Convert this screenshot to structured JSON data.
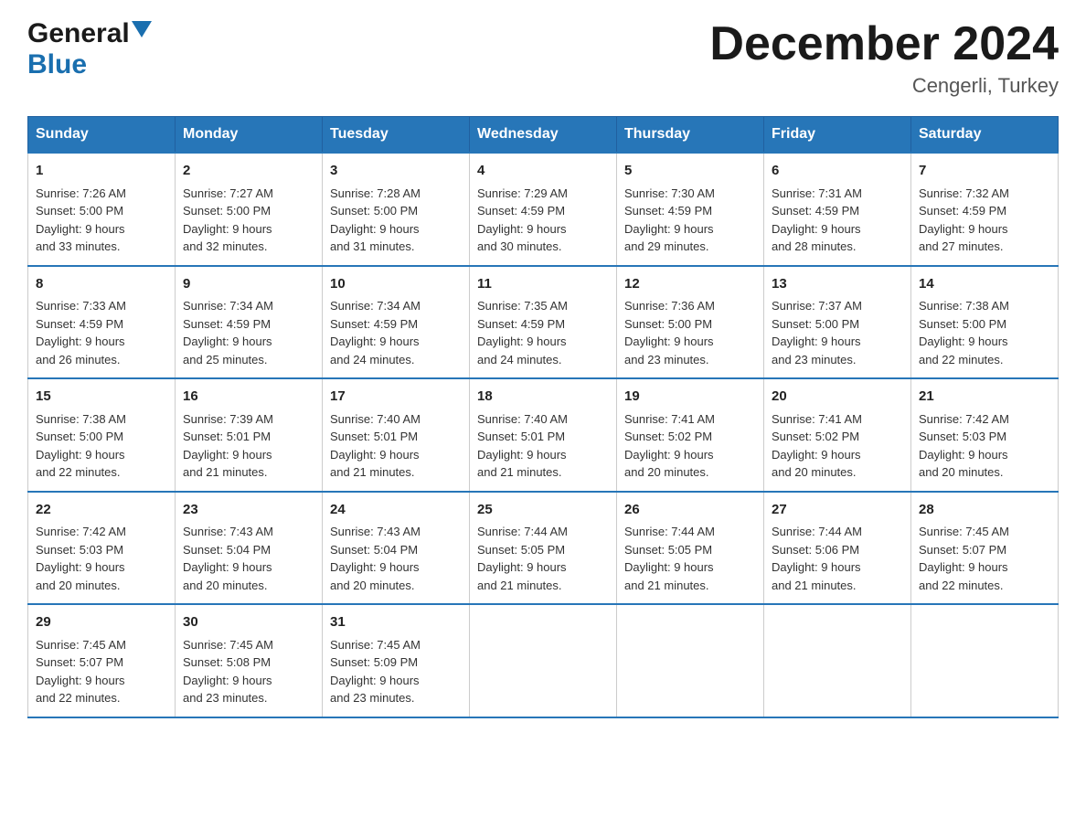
{
  "header": {
    "logo_general": "General",
    "logo_blue": "Blue",
    "month_title": "December 2024",
    "location": "Cengerli, Turkey"
  },
  "days_of_week": [
    "Sunday",
    "Monday",
    "Tuesday",
    "Wednesday",
    "Thursday",
    "Friday",
    "Saturday"
  ],
  "weeks": [
    [
      {
        "day": "1",
        "sunrise": "7:26 AM",
        "sunset": "5:00 PM",
        "daylight": "9 hours and 33 minutes."
      },
      {
        "day": "2",
        "sunrise": "7:27 AM",
        "sunset": "5:00 PM",
        "daylight": "9 hours and 32 minutes."
      },
      {
        "day": "3",
        "sunrise": "7:28 AM",
        "sunset": "5:00 PM",
        "daylight": "9 hours and 31 minutes."
      },
      {
        "day": "4",
        "sunrise": "7:29 AM",
        "sunset": "4:59 PM",
        "daylight": "9 hours and 30 minutes."
      },
      {
        "day": "5",
        "sunrise": "7:30 AM",
        "sunset": "4:59 PM",
        "daylight": "9 hours and 29 minutes."
      },
      {
        "day": "6",
        "sunrise": "7:31 AM",
        "sunset": "4:59 PM",
        "daylight": "9 hours and 28 minutes."
      },
      {
        "day": "7",
        "sunrise": "7:32 AM",
        "sunset": "4:59 PM",
        "daylight": "9 hours and 27 minutes."
      }
    ],
    [
      {
        "day": "8",
        "sunrise": "7:33 AM",
        "sunset": "4:59 PM",
        "daylight": "9 hours and 26 minutes."
      },
      {
        "day": "9",
        "sunrise": "7:34 AM",
        "sunset": "4:59 PM",
        "daylight": "9 hours and 25 minutes."
      },
      {
        "day": "10",
        "sunrise": "7:34 AM",
        "sunset": "4:59 PM",
        "daylight": "9 hours and 24 minutes."
      },
      {
        "day": "11",
        "sunrise": "7:35 AM",
        "sunset": "4:59 PM",
        "daylight": "9 hours and 24 minutes."
      },
      {
        "day": "12",
        "sunrise": "7:36 AM",
        "sunset": "5:00 PM",
        "daylight": "9 hours and 23 minutes."
      },
      {
        "day": "13",
        "sunrise": "7:37 AM",
        "sunset": "5:00 PM",
        "daylight": "9 hours and 23 minutes."
      },
      {
        "day": "14",
        "sunrise": "7:38 AM",
        "sunset": "5:00 PM",
        "daylight": "9 hours and 22 minutes."
      }
    ],
    [
      {
        "day": "15",
        "sunrise": "7:38 AM",
        "sunset": "5:00 PM",
        "daylight": "9 hours and 22 minutes."
      },
      {
        "day": "16",
        "sunrise": "7:39 AM",
        "sunset": "5:01 PM",
        "daylight": "9 hours and 21 minutes."
      },
      {
        "day": "17",
        "sunrise": "7:40 AM",
        "sunset": "5:01 PM",
        "daylight": "9 hours and 21 minutes."
      },
      {
        "day": "18",
        "sunrise": "7:40 AM",
        "sunset": "5:01 PM",
        "daylight": "9 hours and 21 minutes."
      },
      {
        "day": "19",
        "sunrise": "7:41 AM",
        "sunset": "5:02 PM",
        "daylight": "9 hours and 20 minutes."
      },
      {
        "day": "20",
        "sunrise": "7:41 AM",
        "sunset": "5:02 PM",
        "daylight": "9 hours and 20 minutes."
      },
      {
        "day": "21",
        "sunrise": "7:42 AM",
        "sunset": "5:03 PM",
        "daylight": "9 hours and 20 minutes."
      }
    ],
    [
      {
        "day": "22",
        "sunrise": "7:42 AM",
        "sunset": "5:03 PM",
        "daylight": "9 hours and 20 minutes."
      },
      {
        "day": "23",
        "sunrise": "7:43 AM",
        "sunset": "5:04 PM",
        "daylight": "9 hours and 20 minutes."
      },
      {
        "day": "24",
        "sunrise": "7:43 AM",
        "sunset": "5:04 PM",
        "daylight": "9 hours and 20 minutes."
      },
      {
        "day": "25",
        "sunrise": "7:44 AM",
        "sunset": "5:05 PM",
        "daylight": "9 hours and 21 minutes."
      },
      {
        "day": "26",
        "sunrise": "7:44 AM",
        "sunset": "5:05 PM",
        "daylight": "9 hours and 21 minutes."
      },
      {
        "day": "27",
        "sunrise": "7:44 AM",
        "sunset": "5:06 PM",
        "daylight": "9 hours and 21 minutes."
      },
      {
        "day": "28",
        "sunrise": "7:45 AM",
        "sunset": "5:07 PM",
        "daylight": "9 hours and 22 minutes."
      }
    ],
    [
      {
        "day": "29",
        "sunrise": "7:45 AM",
        "sunset": "5:07 PM",
        "daylight": "9 hours and 22 minutes."
      },
      {
        "day": "30",
        "sunrise": "7:45 AM",
        "sunset": "5:08 PM",
        "daylight": "9 hours and 23 minutes."
      },
      {
        "day": "31",
        "sunrise": "7:45 AM",
        "sunset": "5:09 PM",
        "daylight": "9 hours and 23 minutes."
      },
      null,
      null,
      null,
      null
    ]
  ],
  "labels": {
    "sunrise_prefix": "Sunrise: ",
    "sunset_prefix": "Sunset: ",
    "daylight_prefix": "Daylight: "
  }
}
